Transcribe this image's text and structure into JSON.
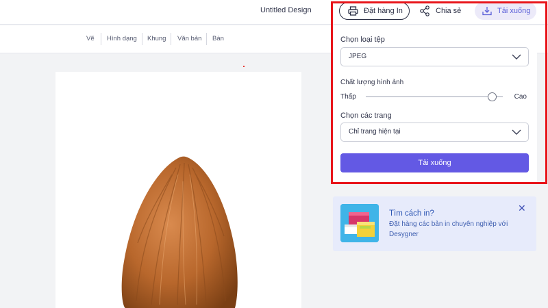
{
  "header": {
    "title": "Untitled Design",
    "print_label": "Đặt hàng In",
    "share_label": "Chia sẻ",
    "download_label": "Tải xuống"
  },
  "toolbar": {
    "items": [
      "Vẽ",
      "Hình dạng",
      "Khung",
      "Văn bản",
      "Bàn"
    ]
  },
  "download_panel": {
    "file_type_label": "Chọn loại tệp",
    "file_type_value": "JPEG",
    "quality_label": "Chất lượng hình ảnh",
    "quality_low": "Thấp",
    "quality_high": "Cao",
    "quality_level": 0.92,
    "pages_label": "Chọn các trang",
    "pages_value": "Chỉ trang hiện tại",
    "submit_label": "Tải xuống"
  },
  "promo": {
    "title": "Tìm cách in?",
    "description": "Đặt hàng các bản in chuyên nghiệp với Desygner",
    "close_icon": "close-icon"
  },
  "colors": {
    "accent": "#6359e4",
    "highlight": "#e8141a",
    "promo_bg": "#e7ebfb",
    "link_blue": "#2d56b3"
  },
  "icons": [
    "printer-icon",
    "share-icon",
    "download-icon",
    "chevron-down-icon",
    "close-icon"
  ]
}
